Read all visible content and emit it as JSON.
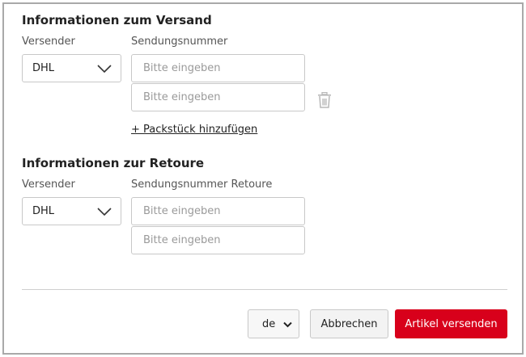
{
  "shipping": {
    "title": "Informationen zum Versand",
    "carrier_label": "Versender",
    "carrier_value": "DHL",
    "tracking_label": "Sendungsnummer",
    "tracking_inputs": [
      {
        "value": "",
        "placeholder": "Bitte eingeben"
      },
      {
        "value": "",
        "placeholder": "Bitte eingeben"
      }
    ],
    "add_package_label": "+ Packstück hinzufügen"
  },
  "returns": {
    "title": "Informationen zur Retoure",
    "carrier_label": "Versender",
    "carrier_value": "DHL",
    "tracking_label": "Sendungsnummer Retoure",
    "tracking_inputs": [
      {
        "value": "",
        "placeholder": "Bitte eingeben"
      },
      {
        "value": "",
        "placeholder": "Bitte eingeben"
      }
    ]
  },
  "footer": {
    "language": "de",
    "cancel_label": "Abbrechen",
    "submit_label": "Artikel versenden"
  },
  "icons": {
    "carrier_dropdown": "chevron-down-icon",
    "remove_package": "trash-icon",
    "language_dropdown": "chevron-down-icon"
  },
  "colors": {
    "primary": "#d8001b",
    "border": "#c8c8c8",
    "trash": "#b8b8b8"
  }
}
